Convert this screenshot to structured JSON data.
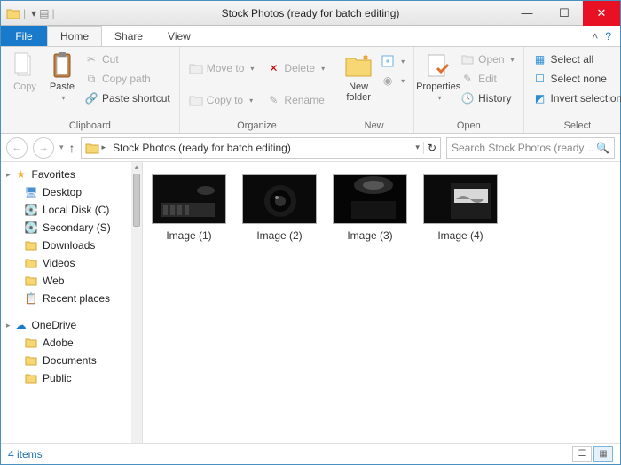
{
  "window": {
    "title": "Stock Photos (ready for batch editing)"
  },
  "tabs": {
    "file": "File",
    "home": "Home",
    "share": "Share",
    "view": "View"
  },
  "ribbon": {
    "clipboard": {
      "label": "Clipboard",
      "copy": "Copy",
      "paste": "Paste",
      "cut": "Cut",
      "copy_path": "Copy path",
      "paste_shortcut": "Paste shortcut"
    },
    "organize": {
      "label": "Organize",
      "move_to": "Move to",
      "copy_to": "Copy to",
      "delete": "Delete",
      "rename": "Rename"
    },
    "new": {
      "label": "New",
      "new_folder": "New\nfolder"
    },
    "open": {
      "label": "Open",
      "properties": "Properties",
      "open": "Open",
      "edit": "Edit",
      "history": "History"
    },
    "select": {
      "label": "Select",
      "select_all": "Select all",
      "select_none": "Select none",
      "invert": "Invert selection"
    }
  },
  "address": {
    "path": "Stock Photos (ready for batch editing)"
  },
  "search": {
    "placeholder": "Search Stock Photos (ready fo..."
  },
  "nav": {
    "favorites": "Favorites",
    "desktop": "Desktop",
    "local_c": "Local Disk (C)",
    "secondary_s": "Secondary (S)",
    "downloads": "Downloads",
    "videos": "Videos",
    "web": "Web",
    "recent": "Recent places",
    "onedrive": "OneDrive",
    "adobe": "Adobe",
    "documents": "Documents",
    "public": "Public"
  },
  "files": [
    {
      "name": "Image (1)"
    },
    {
      "name": "Image (2)"
    },
    {
      "name": "Image (3)"
    },
    {
      "name": "Image (4)"
    }
  ],
  "status": {
    "items": "4 items"
  }
}
